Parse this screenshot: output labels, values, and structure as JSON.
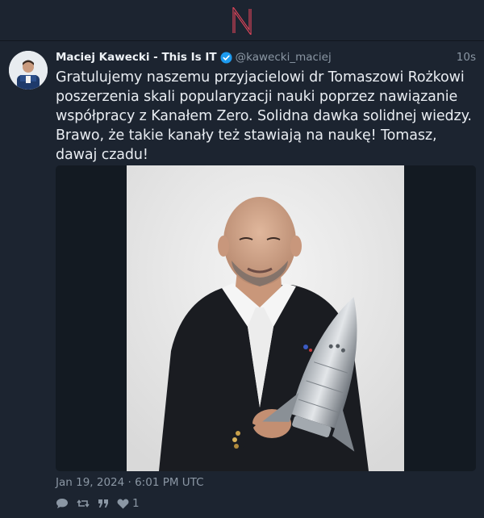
{
  "app": {
    "logo_letter": "N",
    "brand_color": "#e0455a"
  },
  "post": {
    "author": "Maciej Kawecki - This Is IT",
    "handle": "@kawecki_maciej",
    "verified": true,
    "time_ago": "10s",
    "text": "Gratulujemy naszemu przyjacielowi dr Tomaszowi Rożkowi poszerzenia skali popularyzacji nauki poprzez nawiązanie współpracy z Kanałem Zero. Solidna dawka solidnej wiedzy. Brawo, że takie kanały też stawiają na naukę! Tomasz, dawaj czadu!",
    "date": "Jan 19, 2024 · 6:01 PM UTC",
    "stats": {
      "likes": "1"
    },
    "icons": [
      "reply-icon",
      "retweet-icon",
      "quote-icon",
      "heart-icon"
    ]
  },
  "colors": {
    "background": "#1c2430",
    "text": "#e9edf2",
    "muted": "#8b97a4",
    "verified": "#1d9bf0"
  }
}
